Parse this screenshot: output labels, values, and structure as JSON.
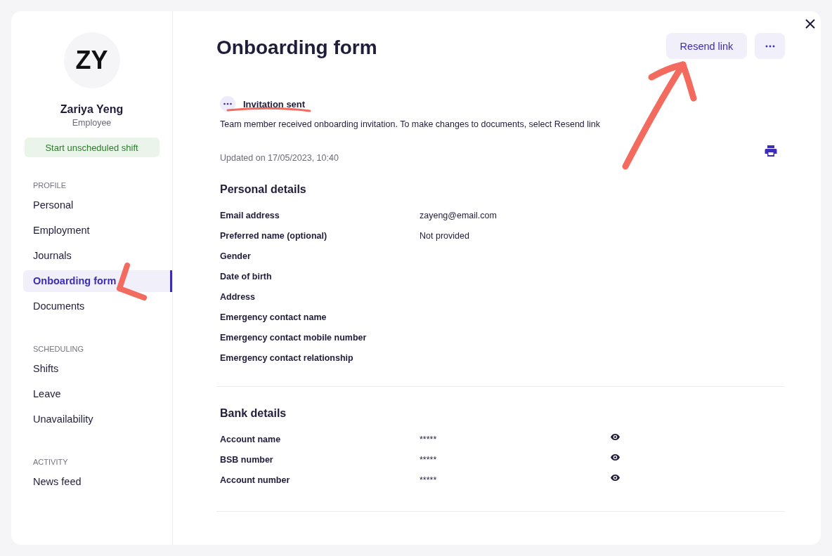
{
  "profile": {
    "initials": "ZY",
    "name": "Zariya Yeng",
    "role": "Employee",
    "action": "Start unscheduled shift"
  },
  "nav": [
    {
      "heading": "PROFILE",
      "items": [
        {
          "label": "Personal",
          "selected": false
        },
        {
          "label": "Employment",
          "selected": false
        },
        {
          "label": "Journals",
          "selected": false
        },
        {
          "label": "Onboarding form",
          "selected": true
        },
        {
          "label": "Documents",
          "selected": false
        }
      ]
    },
    {
      "heading": "SCHEDULING",
      "items": [
        {
          "label": "Shifts",
          "selected": false
        },
        {
          "label": "Leave",
          "selected": false
        },
        {
          "label": "Unavailability",
          "selected": false
        }
      ]
    },
    {
      "heading": "ACTIVITY",
      "items": [
        {
          "label": "News feed",
          "selected": false
        }
      ]
    }
  ],
  "page": {
    "title": "Onboarding form",
    "primary_button": "Resend link"
  },
  "status": {
    "label": "Invitation sent",
    "message": "Team member received onboarding invitation. To make changes to documents, select Resend link",
    "updated": "Updated on 17/05/2023, 10:40"
  },
  "sections": [
    {
      "title": "Personal details",
      "fields": [
        {
          "label": "Email address",
          "value": "zayeng@email.com"
        },
        {
          "label": "Preferred name (optional)",
          "value": "Not provided"
        },
        {
          "label": "Gender"
        },
        {
          "label": "Date of birth"
        },
        {
          "label": "Address"
        },
        {
          "label": "Emergency contact name"
        },
        {
          "label": "Emergency contact mobile number"
        },
        {
          "label": "Emergency contact relationship"
        }
      ]
    },
    {
      "title": "Bank details",
      "fields": [
        {
          "label": "Account name",
          "value": "*****",
          "hidden": true
        },
        {
          "label": "BSB number",
          "value": "*****",
          "hidden": true
        },
        {
          "label": "Account number",
          "value": "*****",
          "hidden": true
        }
      ]
    }
  ]
}
